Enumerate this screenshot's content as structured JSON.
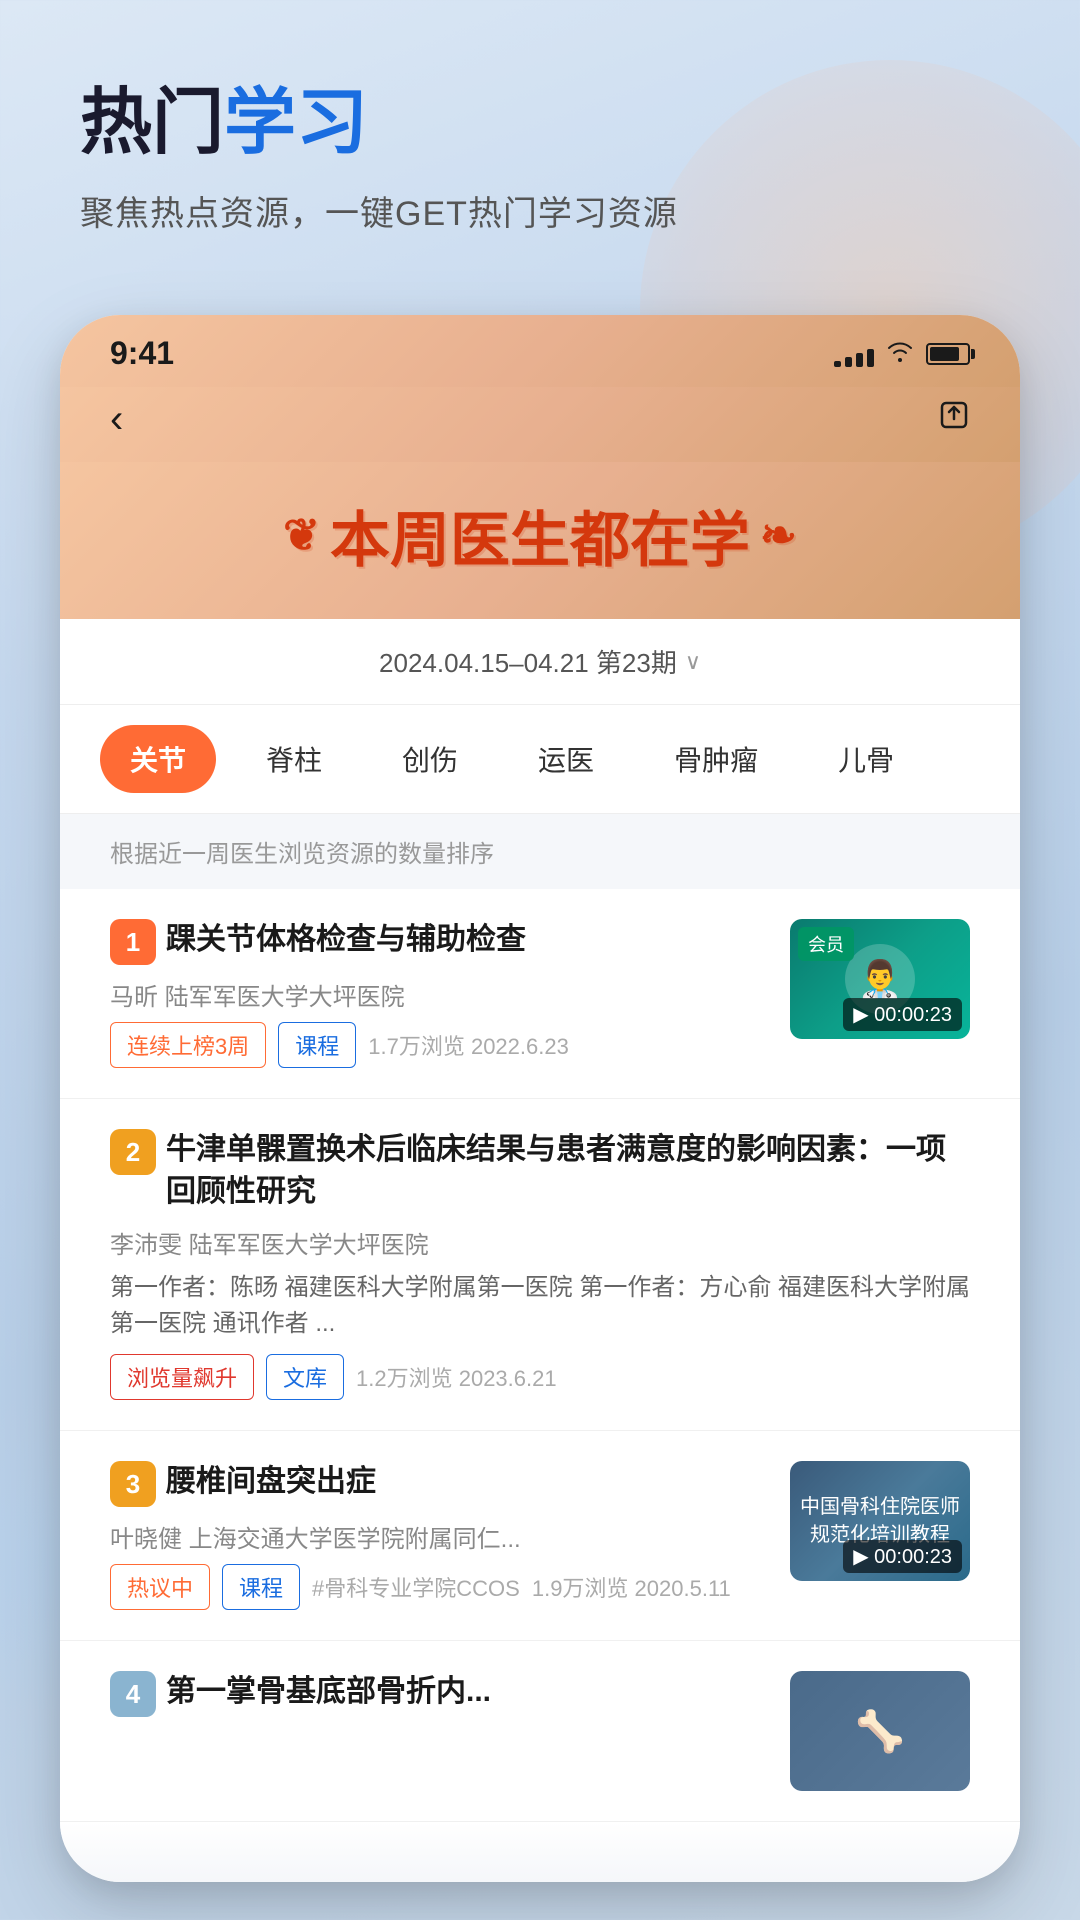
{
  "page": {
    "background": "light-blue-gradient"
  },
  "header": {
    "title_black": "热门",
    "title_blue": "学习",
    "subtitle": "聚焦热点资源，一键GET热门学习资源"
  },
  "phone": {
    "status_bar": {
      "time": "9:41",
      "signal_bars": [
        6,
        10,
        14,
        18,
        22
      ],
      "wifi": "WiFi",
      "battery_percent": 80
    },
    "nav": {
      "back_label": "‹",
      "share_label": "⬆"
    },
    "banner": {
      "wheat_left": "❦",
      "title": "本周医生都在学",
      "wheat_right": "❧"
    },
    "date_selector": {
      "text": "2024.04.15–04.21 第23期",
      "chevron": "∨"
    },
    "categories": [
      {
        "id": "guanjie",
        "label": "关节",
        "active": true
      },
      {
        "id": "jizhu",
        "label": "脊柱",
        "active": false
      },
      {
        "id": "chuangshang",
        "label": "创伤",
        "active": false
      },
      {
        "id": "yuny",
        "label": "运医",
        "active": false
      },
      {
        "id": "guzl",
        "label": "骨肿瘤",
        "active": false
      },
      {
        "id": "erg",
        "label": "儿骨",
        "active": false
      }
    ],
    "sort_notice": "根据近一周医生浏览资源的数量排序",
    "items": [
      {
        "rank": "1",
        "rank_class": "rank-1",
        "title": "踝关节体格检查与辅助检查",
        "author": "马昕  陆军军医大学大坪医院",
        "tags": [
          {
            "label": "连续上榜3周",
            "type": "tag-orange"
          },
          {
            "label": "课程",
            "type": "tag-blue"
          }
        ],
        "meta": "1.7万浏览  2022.6.23",
        "has_thumb": true,
        "thumb_type": "video",
        "thumb_label": "会员",
        "thumb_time": "▶ 00:00:23",
        "thumb_bg": "teal"
      },
      {
        "rank": "2",
        "rank_class": "rank-2",
        "title": "牛津单髁置换术后临床结果与患者满意度的影响因素：一项回顾性研究",
        "author": "李沛雯  陆军军医大学大坪医院",
        "abstract": "第一作者：陈旸 福建医科大学附属第一医院 第一作者：方心俞 福建医科大学附属第一医院 通讯作者 ...",
        "tags": [
          {
            "label": "浏览量飙升",
            "type": "tag-red"
          },
          {
            "label": "文库",
            "type": "tag-blue"
          }
        ],
        "meta": "1.2万浏览  2023.6.21",
        "has_thumb": false
      },
      {
        "rank": "3",
        "rank_class": "rank-3",
        "title": "腰椎间盘突出症",
        "author": "叶晓健  上海交通大学医学院附属同仁...",
        "tags": [
          {
            "label": "热议中",
            "type": "tag-orange"
          },
          {
            "label": "课程",
            "type": "tag-blue"
          },
          {
            "label": "#骨科专业学院CCOS",
            "type": "tag-meta"
          }
        ],
        "meta": "1.9万浏览  2020.5.11",
        "has_thumb": true,
        "thumb_type": "video2",
        "thumb_time": "▶ 00:00:23",
        "thumb_bg": "blue-gray",
        "thumb_text": "中国骨科住院医师\n规范化培训教程"
      },
      {
        "rank": "4",
        "rank_class": "rank-4",
        "title": "第一掌骨基底部骨折内...",
        "has_thumb": true,
        "thumb_type": "video3"
      }
    ]
  }
}
